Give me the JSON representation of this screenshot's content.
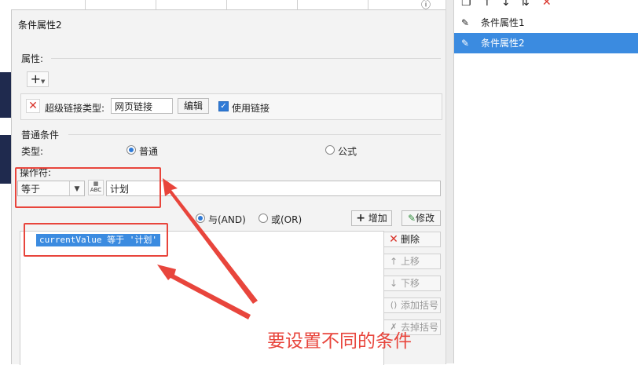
{
  "dialog": {
    "title": "条件属性2",
    "property_label": "属性:",
    "add_symbol": "+",
    "hyperlink_label": "超级链接类型:",
    "hyperlink_value": "网页链接",
    "edit_button": "编辑",
    "use_link_label": "使用链接",
    "use_link_checked": true,
    "normal_condition_label": "普通条件",
    "type_label": "类型:",
    "type_normal": "普通",
    "type_formula": "公式",
    "operator_label": "操作符:",
    "operator_value": "等于",
    "value_input": "计划",
    "and_label": "与(AND)",
    "or_label": "或(OR)",
    "add_button": "增加",
    "modify_button": "修改",
    "condition_item": "currentValue 等于 '计划'",
    "delete_button": "删除",
    "up_button": "上移",
    "down_button": "下移",
    "add_bracket_button": "添加括号",
    "remove_bracket_button": "去掉括号"
  },
  "annotation": {
    "text": "要设置不同的条件",
    "color": "#e8453c"
  },
  "right_panel": {
    "items": [
      {
        "label": "条件属性1",
        "selected": false
      },
      {
        "label": "条件属性2",
        "selected": true
      }
    ]
  },
  "colors": {
    "accent": "#3b8be0",
    "annotation_red": "#e8453c",
    "sidebar_navy": "#1f2a4e"
  }
}
